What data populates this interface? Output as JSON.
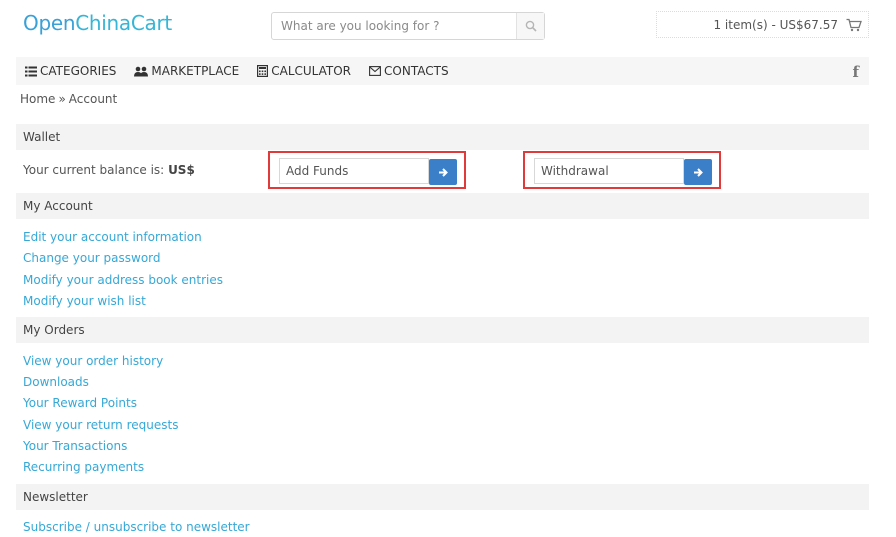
{
  "header": {
    "logo_part1": "Open",
    "logo_part2": "ChinaCart",
    "search_placeholder": "What are you looking for ?",
    "cart_summary": "1 item(s) - US$67.57"
  },
  "nav": {
    "items": [
      {
        "label": "CATEGORIES",
        "icon": "list-icon"
      },
      {
        "label": "MARKETPLACE",
        "icon": "users-icon"
      },
      {
        "label": "CALCULATOR",
        "icon": "calculator-icon"
      },
      {
        "label": "CONTACTS",
        "icon": "envelope-icon"
      }
    ],
    "social": "f"
  },
  "breadcrumb": {
    "home": "Home",
    "separator": "»",
    "current": "Account"
  },
  "wallet": {
    "title": "Wallet",
    "balance_label": "Your current balance is:",
    "balance_value": "US$",
    "add_funds": "Add Funds",
    "withdrawal": "Withdrawal"
  },
  "my_account": {
    "title": "My Account",
    "links": [
      "Edit your account information",
      "Change your password",
      "Modify your address book entries",
      "Modify your wish list"
    ]
  },
  "my_orders": {
    "title": "My Orders",
    "links": [
      "View your order history",
      "Downloads",
      "Your Reward Points",
      "View your return requests",
      "Your Transactions",
      "Recurring payments"
    ]
  },
  "newsletter": {
    "title": "Newsletter",
    "links": [
      "Subscribe / unsubscribe to newsletter"
    ]
  },
  "colors": {
    "link": "#36a8d6",
    "accent_button": "#3b7fc8",
    "highlight_border": "#e03a3a"
  }
}
